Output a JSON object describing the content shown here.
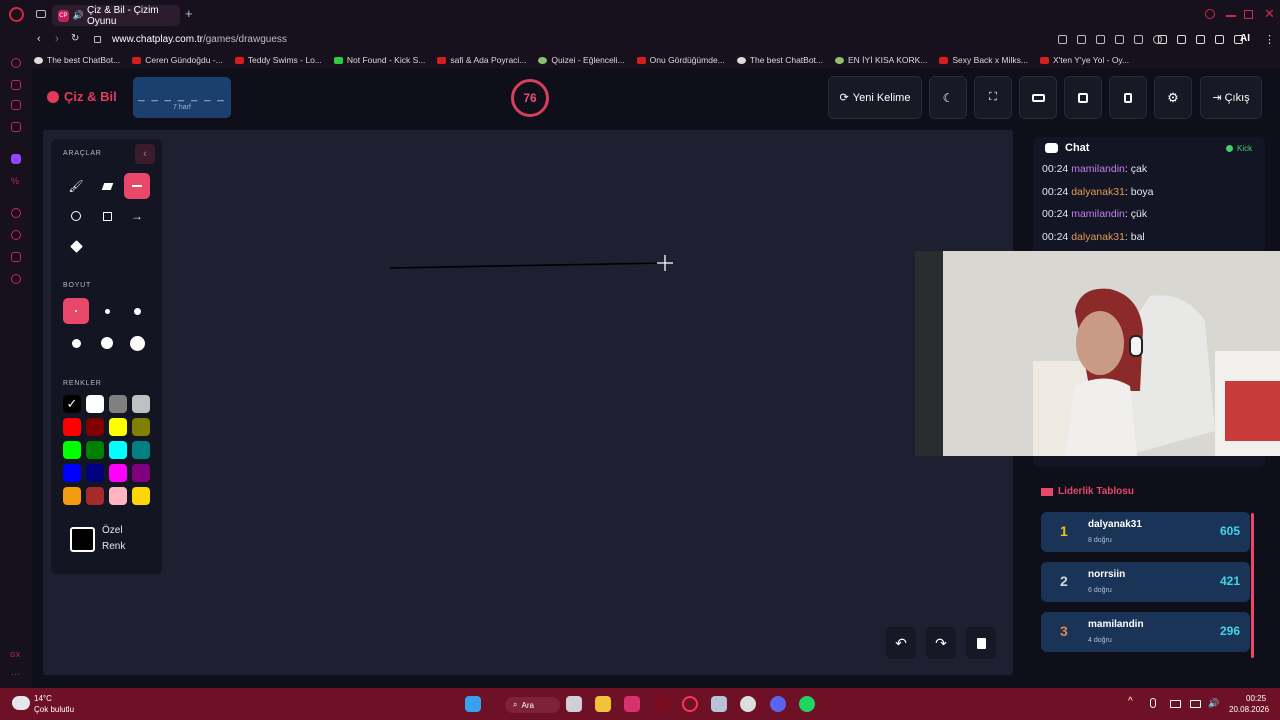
{
  "browser": {
    "tab_title": "Çiz & Bil - Çizim Oyunu",
    "tab_favicon": "CP",
    "url_host": "www.chatplay.com.tr",
    "url_path": "/games/drawguess",
    "ai_label": "AI",
    "bookmarks": [
      "The best ChatBot...",
      "Ceren Gündoğdu -...",
      "Teddy Swims - Lo...",
      "Not Found - Kick S...",
      "safi & Ada Poyraci...",
      "Quizei - Eğlenceli...",
      "Onu Gördüğümde...",
      "The best ChatBot...",
      "EN İYİ KISA KORK...",
      "Sexy Back x Milks...",
      "X'ten Y'ye Yol - Oy..."
    ]
  },
  "header": {
    "brand": "Çiz & Bil",
    "word_dashes": "_ _ _ _ _ _ _",
    "word_hint": "7 harf",
    "timer": "76",
    "new_word_label": "Yeni Kelime",
    "exit_label": "Çıkış"
  },
  "tools": {
    "section_tools": "ARAÇLAR",
    "section_size": "BOYUT",
    "section_colors": "RENKLER",
    "custom_color_label": "Özel Renk",
    "active_tool": "line",
    "colors": [
      "#000000",
      "#ffffff",
      "#808080",
      "#c0c0c0",
      "#ff0000",
      "#800000",
      "#ffff00",
      "#808000",
      "#00ff00",
      "#008000",
      "#00ffff",
      "#008080",
      "#0000ff",
      "#000080",
      "#ff00ff",
      "#800080",
      "#f39c12",
      "#a52a2a",
      "#ffb6c1",
      "#ffd700"
    ],
    "selected_color": "#000000"
  },
  "chat": {
    "title": "Chat",
    "platform": "Kick",
    "messages": [
      {
        "time": "00:24",
        "user": "mamilandin",
        "text": ": çak"
      },
      {
        "time": "00:24",
        "user": "dalyanak31",
        "text": ": boya"
      },
      {
        "time": "00:24",
        "user": "mamilandin",
        "text": ": çük"
      },
      {
        "time": "00:24",
        "user": "dalyanak31",
        "text": ": bal"
      }
    ]
  },
  "leaderboard": {
    "title": "Liderlik Tablosu",
    "rows": [
      {
        "rank": "1",
        "name": "dalyanak31",
        "sub": "8 doğru",
        "score": "605",
        "rank_color": "#f1c40f"
      },
      {
        "rank": "2",
        "name": "norrsiin",
        "sub": "6 doğru",
        "score": "421",
        "rank_color": "#cfd6e0"
      },
      {
        "rank": "3",
        "name": "mamilandin",
        "sub": "4 doğru",
        "score": "296",
        "rank_color": "#e0874a"
      }
    ]
  },
  "taskbar": {
    "weather_temp": "14°C",
    "weather_desc": "Çok bulutlu",
    "search_label": "Ara",
    "time": "00:25",
    "date": "20.08.2026"
  },
  "theme": {
    "accent": "#e9486a",
    "canvas_bg": "#1e2032",
    "panel_bg": "#141523",
    "leader_row_bg": "#1a3458"
  }
}
